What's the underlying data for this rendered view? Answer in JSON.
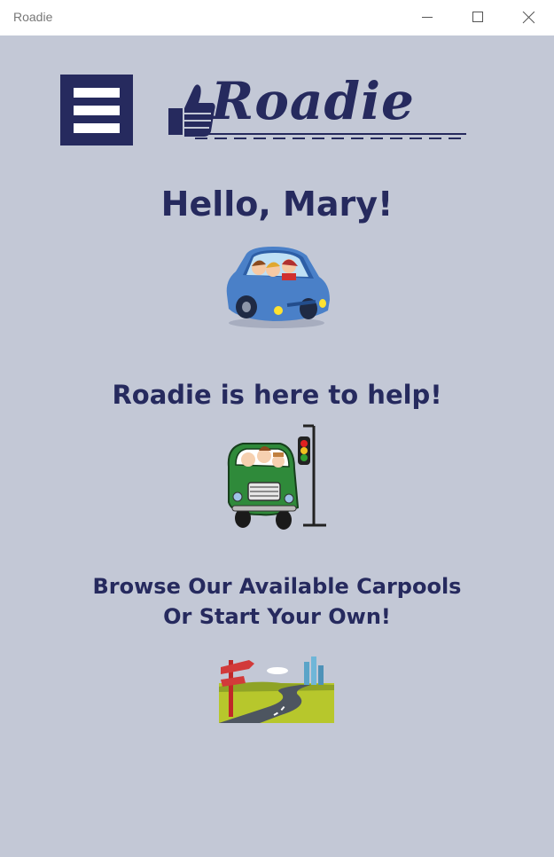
{
  "window": {
    "title": "Roadie"
  },
  "logo": {
    "text": "Roadie"
  },
  "greeting": "Hello, Mary!",
  "tagline": "Roadie is here to help!",
  "cta": {
    "line1": "Browse Our Available Carpools",
    "line2": "Or Start Your Own!"
  },
  "icons": {
    "menu": "hamburger-menu-icon",
    "logo": "thumbs-up-icon",
    "car_family": "blue-car-family-illustration",
    "car_traffic": "green-car-traffic-light-illustration",
    "road": "winding-road-signpost-illustration"
  },
  "colors": {
    "brand": "#262a5e",
    "background": "#c3c8d6"
  }
}
